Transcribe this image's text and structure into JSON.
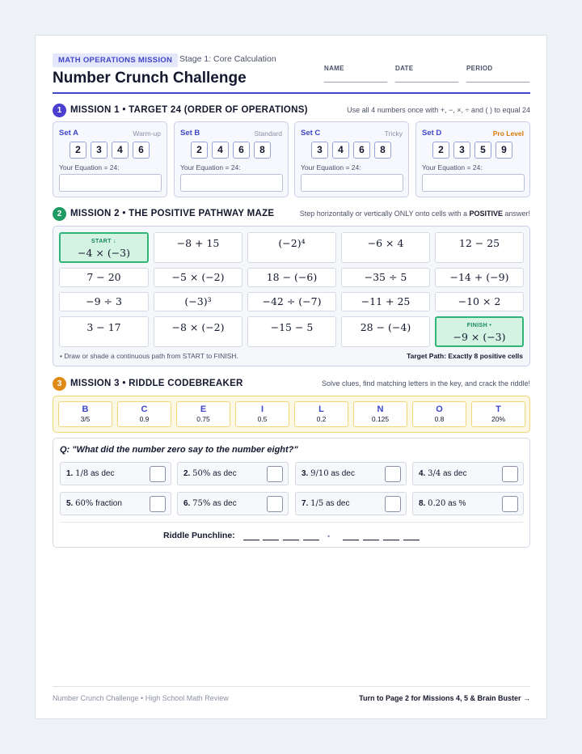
{
  "header": {
    "badge": "MATH OPERATIONS MISSION",
    "stage": "Stage 1: Core Calculation",
    "title": "Number Crunch Challenge",
    "fields": [
      "NAME",
      "DATE",
      "PERIOD"
    ]
  },
  "mission1": {
    "number": "1",
    "title": "MISSION 1 • TARGET 24 (ORDER OF OPERATIONS)",
    "note": "Use all 4 numbers once with +, −, ×, ÷ and ( ) to equal 24",
    "sets": [
      {
        "name": "Set A",
        "level": "Warm-up",
        "digits": [
          "2",
          "3",
          "4",
          "6"
        ],
        "eq": "Your Equation = 24:"
      },
      {
        "name": "Set B",
        "level": "Standard",
        "digits": [
          "2",
          "4",
          "6",
          "8"
        ],
        "eq": "Your Equation = 24:"
      },
      {
        "name": "Set C",
        "level": "Tricky",
        "digits": [
          "3",
          "4",
          "6",
          "8"
        ],
        "eq": "Your Equation = 24:"
      },
      {
        "name": "Set D",
        "level": "Pro Level",
        "digits": [
          "2",
          "3",
          "5",
          "9"
        ],
        "eq": "Your Equation = 24:"
      }
    ]
  },
  "mission2": {
    "number": "2",
    "title": "MISSION 2 • THE POSITIVE PATHWAY MAZE",
    "note_pre": "Step horizontally or vertically ONLY onto cells with a ",
    "note_bold": "POSITIVE",
    "note_post": " answer!",
    "start_tag": "START ↓",
    "finish_tag": "FINISH •",
    "rows": [
      [
        "−4 × (−3)",
        "−8 + 15",
        "(−2)⁴",
        "−6 × 4",
        "12 − 25"
      ],
      [
        "7 − 20",
        "−5 × (−2)",
        "18 − (−6)",
        "−35 ÷ 5",
        "−14 + (−9)"
      ],
      [
        "−9 ÷ 3",
        "(−3)³",
        "−42 ÷ (−7)",
        "−11 + 25",
        "−10 × 2"
      ],
      [
        "3 − 17",
        "−8 × (−2)",
        "−15 − 5",
        "28 − (−4)",
        "−9 × (−3)"
      ]
    ],
    "footer_left": "• Draw or shade a continuous path from START to FINISH.",
    "footer_right": "Target Path: Exactly 8 positive cells"
  },
  "mission3": {
    "number": "3",
    "title": "MISSION 3 • RIDDLE CODEBREAKER",
    "note": "Solve clues, find matching letters in the key, and crack the riddle!",
    "key": [
      {
        "letter": "B",
        "value": "3/5"
      },
      {
        "letter": "C",
        "value": "0.9"
      },
      {
        "letter": "E",
        "value": "0.75"
      },
      {
        "letter": "I",
        "value": "0.5"
      },
      {
        "letter": "L",
        "value": "0.2"
      },
      {
        "letter": "N",
        "value": "0.125"
      },
      {
        "letter": "O",
        "value": "0.8"
      },
      {
        "letter": "T",
        "value": "20%"
      }
    ],
    "question": "Q: \"What did the number zero say to the number eight?\"",
    "clues": [
      {
        "n": "1.",
        "expr": "1/8",
        "text": " as dec"
      },
      {
        "n": "2.",
        "expr": "50%",
        "text": " as dec"
      },
      {
        "n": "3.",
        "expr": "9/10",
        "text": " as dec"
      },
      {
        "n": "4.",
        "expr": "3/4",
        "text": " as dec"
      },
      {
        "n": "5.",
        "expr": "60%",
        "text": " fraction"
      },
      {
        "n": "6.",
        "expr": "75%",
        "text": " as dec"
      },
      {
        "n": "7.",
        "expr": "1/5",
        "text": " as dec"
      },
      {
        "n": "8.",
        "expr": "0.20",
        "text": " as %"
      }
    ],
    "punchline_label": "Riddle Punchline:",
    "separator": "•"
  },
  "footer": {
    "left": "Number Crunch Challenge • High School Math Review",
    "right": "Turn to Page 2 for Missions 4, 5 & Brain Buster →"
  },
  "colors": {
    "accent": "#3f47c8",
    "mission1": "#4a3fd0",
    "mission2": "#1f9a63",
    "mission3": "#e08a16",
    "pro_level": "#d97706"
  }
}
